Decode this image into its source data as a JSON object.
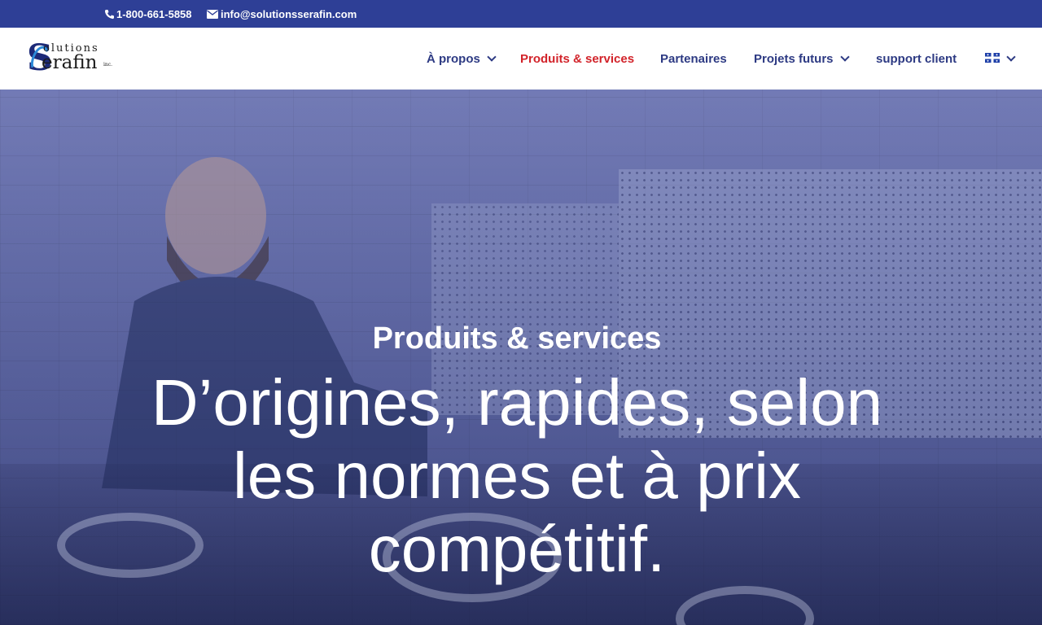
{
  "topbar": {
    "phone": "1-800-661-5858",
    "email": "info@solutionsserafin.com",
    "bg_color": "#2e3f96"
  },
  "logo": {
    "line1": "olutions",
    "line2": "erafin",
    "suffix": "inc."
  },
  "nav": {
    "items": [
      {
        "label": "À propos",
        "has_dropdown": true,
        "active": false
      },
      {
        "label": "Produits & services",
        "has_dropdown": false,
        "active": true
      },
      {
        "label": "Partenaires",
        "has_dropdown": false,
        "active": false
      },
      {
        "label": "Projets futurs",
        "has_dropdown": true,
        "active": false
      },
      {
        "label": "support client",
        "has_dropdown": false,
        "active": false
      }
    ],
    "language_icon": "flag-quebec-icon",
    "text_color": "#2d3a83",
    "active_color": "#d2232a"
  },
  "hero": {
    "subtitle": "Produits & services",
    "title_lines": [
      "D’origines, rapides, selon",
      "les normes et à prix",
      "compétitif."
    ],
    "overlay_color": "#34409e"
  }
}
